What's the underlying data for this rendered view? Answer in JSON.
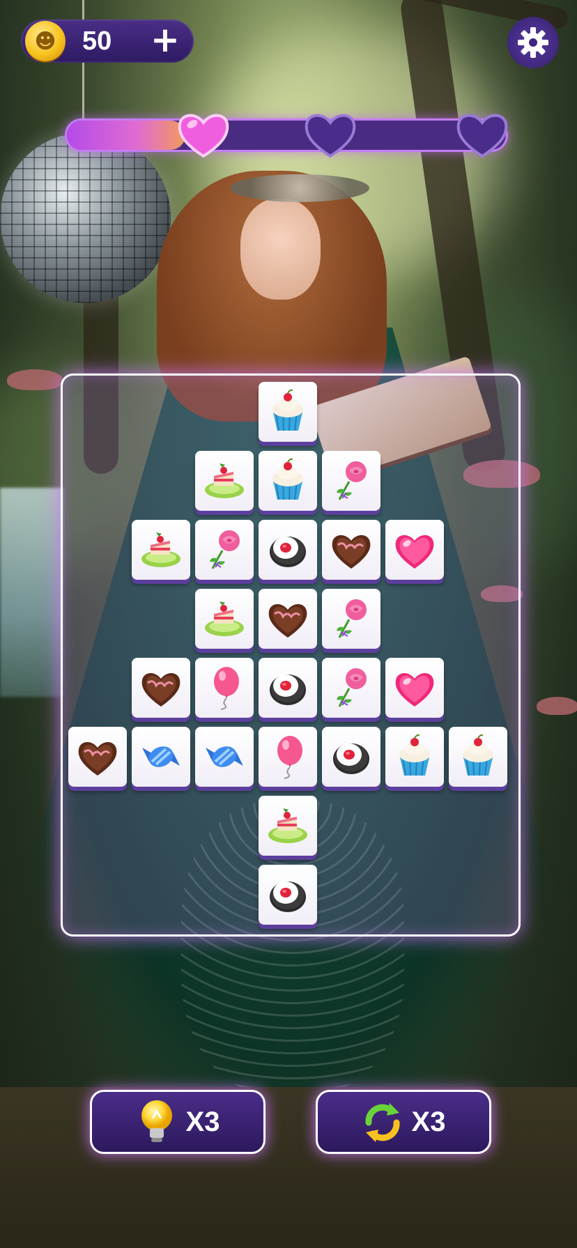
{
  "hud": {
    "coins": "50",
    "add_coins_label": "+",
    "coin_icon": "coin-face-icon",
    "settings_icon": "gear-icon"
  },
  "progress": {
    "fill_fraction": 0.27,
    "hearts": [
      {
        "state": "filled",
        "color": "#f05ee0"
      },
      {
        "state": "empty",
        "color": "#4a2d8a"
      },
      {
        "state": "empty",
        "color": "#4a2d8a"
      }
    ]
  },
  "board": {
    "rows": [
      [
        "",
        "",
        "",
        "cupcake",
        "",
        "",
        ""
      ],
      [
        "",
        "",
        "cake-slice",
        "cupcake",
        "rose",
        "",
        ""
      ],
      [
        "",
        "cake-slice",
        "rose",
        "sushi-roll",
        "chocolate-heart",
        "pink-heart",
        ""
      ],
      [
        "",
        "",
        "cake-slice",
        "chocolate-heart",
        "rose",
        "",
        ""
      ],
      [
        "",
        "chocolate-heart",
        "balloon",
        "sushi-roll",
        "rose",
        "pink-heart",
        ""
      ],
      [
        "chocolate-heart",
        "wrapped-candy",
        "wrapped-candy",
        "balloon",
        "sushi-roll",
        "cupcake",
        "cupcake"
      ],
      [
        "",
        "",
        "",
        "cake-slice",
        "",
        "",
        ""
      ],
      [
        "",
        "",
        "",
        "sushi-roll",
        "",
        "",
        ""
      ]
    ]
  },
  "powerups": {
    "hint": {
      "icon": "lightbulb-icon",
      "count": "X3"
    },
    "shuffle": {
      "icon": "shuffle-arrows-icon",
      "count": "X3"
    }
  },
  "colors": {
    "accent": "#c27ef2",
    "panel": "#2e1a63",
    "tile_base": "#5c3f9c"
  }
}
